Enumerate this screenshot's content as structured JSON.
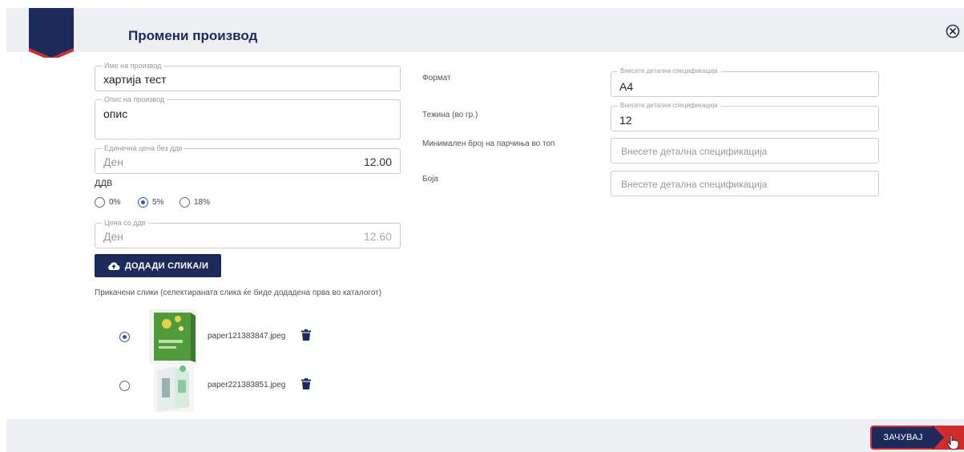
{
  "header": {
    "title": "Промени производ"
  },
  "left": {
    "name_field": {
      "legend": "Име на производ",
      "value": "хартија тест"
    },
    "desc_field": {
      "legend": "Опис на производ",
      "value": "опис"
    },
    "price_field": {
      "legend": "Единечна цена без ддв",
      "unit": "Ден",
      "value": "12.00"
    },
    "ddv": {
      "label": "ДДВ",
      "options": [
        "0%",
        "5%",
        "18%"
      ],
      "selected": "5%"
    },
    "price_vat_field": {
      "legend": "Цена со ддв",
      "unit": "Ден",
      "value": "12.60"
    },
    "upload_label": "ДОДАДИ СЛИКА/И",
    "attached_note": "Прикачени слики (селектираната слика ќе биде додадена прва во каталогот)",
    "images": [
      {
        "filename": "paper121383847.jpeg",
        "selected": true
      },
      {
        "filename": "paper221383851.jpeg",
        "selected": false
      }
    ]
  },
  "specs": [
    {
      "label": "Формат",
      "legend": "Внесете детална спецификација",
      "value": "А4",
      "placeholder": ""
    },
    {
      "label": "Тежина (во гр.)",
      "legend": "Внесете детална спецификација",
      "value": "12",
      "placeholder": ""
    },
    {
      "label": "Минимален број на парчиња во топ",
      "legend": "",
      "value": "",
      "placeholder": "Внесете детална спецификација"
    },
    {
      "label": "Боја",
      "legend": "",
      "value": "",
      "placeholder": "Внесете детална спецификација"
    }
  ],
  "footer": {
    "save_label": "ЗАЧУВАЈ"
  },
  "colors": {
    "brand_navy": "#1d2a5c",
    "accent_red": "#d12b2b",
    "radio_blue": "#3a55a8",
    "bar_gray": "#eeeff2"
  },
  "icons": {
    "close": "close-circle-icon",
    "upload": "cloud-upload-icon",
    "delete": "trash-icon",
    "cursor": "hand-pointer-icon"
  }
}
